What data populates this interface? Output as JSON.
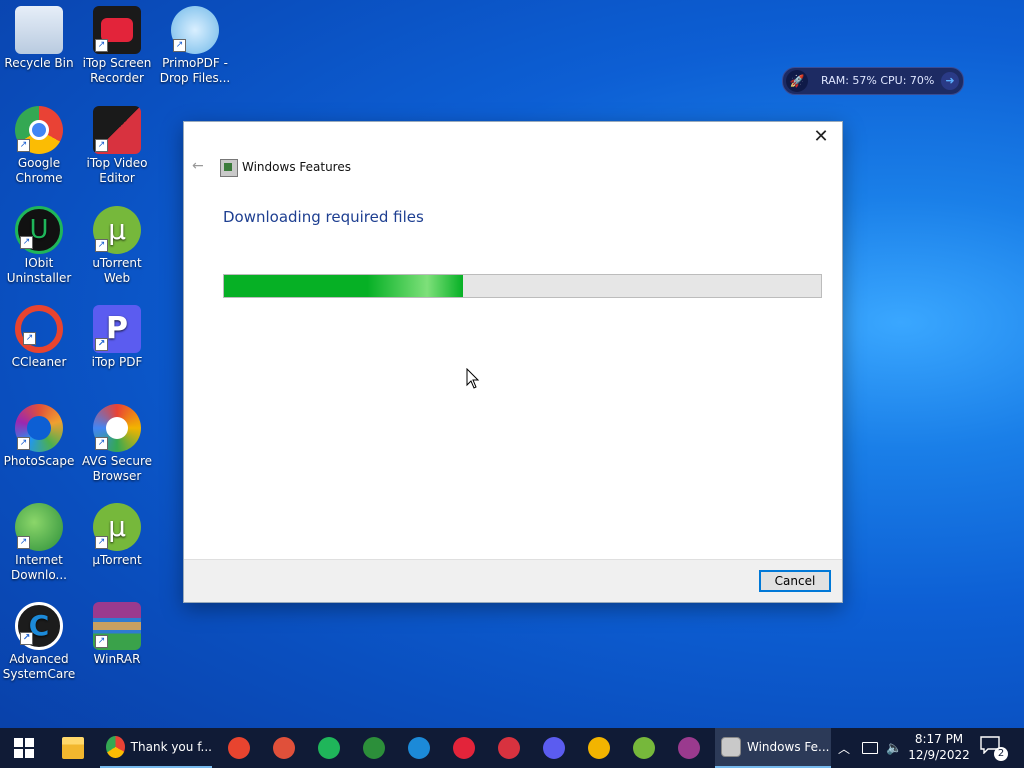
{
  "desktop": {
    "icons": [
      {
        "label": "Recycle Bin",
        "icon": "recycle-bin-icon",
        "color": "#dfe9f5"
      },
      {
        "label": "iTop Screen Recorder",
        "icon": "screen-recorder-icon",
        "color": "#e3243a"
      },
      {
        "label": "PrimoPDF - Drop Files...",
        "icon": "primopdf-icon",
        "color": "#6fb8e8"
      },
      {
        "label": "Google Chrome",
        "icon": "chrome-icon",
        "color": "#e94235"
      },
      {
        "label": "iTop Video Editor",
        "icon": "video-editor-icon",
        "color": "#d8323f"
      },
      {
        "label": "IObit Uninstaller",
        "icon": "iobit-uninstaller-icon",
        "color": "#1fb65a"
      },
      {
        "label": "uTorrent Web",
        "icon": "utorrent-web-icon",
        "color": "#76b83b"
      },
      {
        "label": "CCleaner",
        "icon": "ccleaner-icon",
        "color": "#e8442f"
      },
      {
        "label": "iTop PDF",
        "icon": "itop-pdf-icon",
        "color": "#5b5cf0"
      },
      {
        "label": "PhotoScape",
        "icon": "photoscape-icon",
        "color": "#e0503a"
      },
      {
        "label": "AVG Secure Browser",
        "icon": "avg-browser-icon",
        "color": "#f2b400"
      },
      {
        "label": "Internet Downlo...",
        "icon": "internet-download-manager-icon",
        "color": "#2c8f3a"
      },
      {
        "label": "µTorrent",
        "icon": "utorrent-icon",
        "color": "#76b83b"
      },
      {
        "label": "Advanced SystemCare",
        "icon": "advanced-systemcare-icon",
        "color": "#1c1c1c"
      },
      {
        "label": "WinRAR",
        "icon": "winrar-icon",
        "color": "#9a3a8e"
      }
    ]
  },
  "sysmon": {
    "text": "RAM: 57%   CPU: 70%",
    "rocket": "🚀",
    "arrow": "➜"
  },
  "dialog": {
    "title": "Windows Features",
    "heading": "Downloading required files",
    "progress_fraction": 0.4,
    "cancel_label": "Cancel",
    "close_glyph": "✕",
    "back_glyph": "←",
    "accent_color": "#0078d7",
    "progress_color": "#06b025"
  },
  "taskbar": {
    "chrome_label": "Thank you f...",
    "winfeat_label": "Windows Fe...",
    "time": "8:17 PM",
    "date": "12/9/2022",
    "notification_count": "2",
    "pinned": [
      {
        "icon": "ccleaner-icon",
        "color": "#e8442f"
      },
      {
        "icon": "photoscape-icon",
        "color": "#e0503a"
      },
      {
        "icon": "iobit-uninstaller-icon",
        "color": "#1fb65a"
      },
      {
        "icon": "internet-download-manager-icon",
        "color": "#2c8f3a"
      },
      {
        "icon": "advanced-systemcare-icon",
        "color": "#1c8ad8"
      },
      {
        "icon": "screen-recorder-icon",
        "color": "#e3243a"
      },
      {
        "icon": "video-editor-icon",
        "color": "#d8323f"
      },
      {
        "icon": "itop-pdf-icon",
        "color": "#5b5cf0"
      },
      {
        "icon": "avg-browser-icon",
        "color": "#f2b400"
      },
      {
        "icon": "utorrent-icon",
        "color": "#76b83b"
      },
      {
        "icon": "winrar-icon",
        "color": "#9a3a8e"
      }
    ]
  }
}
